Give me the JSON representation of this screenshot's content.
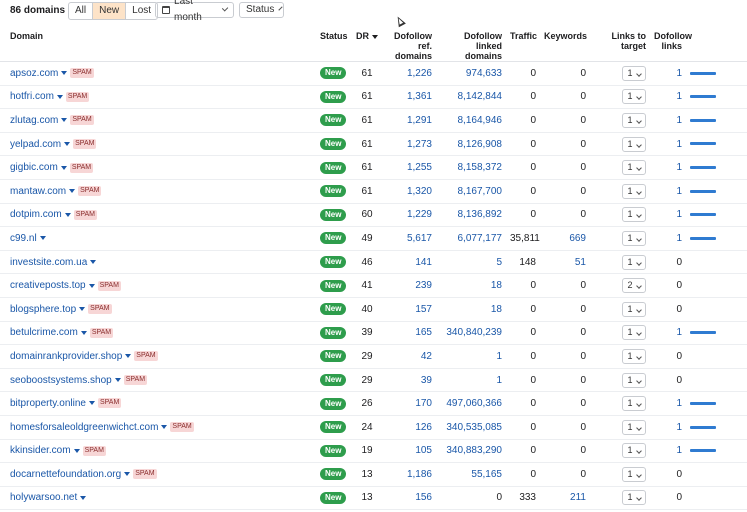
{
  "toolbar": {
    "count": "86 domains",
    "filters": [
      "All",
      "New",
      "Lost"
    ],
    "active_filter": "New",
    "date_range": "Last month",
    "status": "Status"
  },
  "table": {
    "headers": {
      "domain": "Domain",
      "status": "Status",
      "dr": "DR",
      "ref_domains": "Dofollow ref. domains",
      "linked_domains": "Dofollow linked domains",
      "traffic": "Traffic",
      "keywords": "Keywords",
      "links_to_target": "Links to target",
      "dofollow_links": "Dofollow links"
    },
    "rows": [
      {
        "domain": "apsoz.com",
        "spam": true,
        "status": "New",
        "dr": "61",
        "ref": "1,226",
        "linked": "974,633",
        "traffic": "0",
        "keywords": "0",
        "ltt": "1",
        "dl": "1",
        "bar": true
      },
      {
        "domain": "hotfri.com",
        "spam": true,
        "status": "New",
        "dr": "61",
        "ref": "1,361",
        "linked": "8,142,844",
        "traffic": "0",
        "keywords": "0",
        "ltt": "1",
        "dl": "1",
        "bar": true
      },
      {
        "domain": "zlutag.com",
        "spam": true,
        "status": "New",
        "dr": "61",
        "ref": "1,291",
        "linked": "8,164,946",
        "traffic": "0",
        "keywords": "0",
        "ltt": "1",
        "dl": "1",
        "bar": true
      },
      {
        "domain": "yelpad.com",
        "spam": true,
        "status": "New",
        "dr": "61",
        "ref": "1,273",
        "linked": "8,126,908",
        "traffic": "0",
        "keywords": "0",
        "ltt": "1",
        "dl": "1",
        "bar": true
      },
      {
        "domain": "gigbic.com",
        "spam": true,
        "status": "New",
        "dr": "61",
        "ref": "1,255",
        "linked": "8,158,372",
        "traffic": "0",
        "keywords": "0",
        "ltt": "1",
        "dl": "1",
        "bar": true
      },
      {
        "domain": "mantaw.com",
        "spam": true,
        "status": "New",
        "dr": "61",
        "ref": "1,320",
        "linked": "8,167,700",
        "traffic": "0",
        "keywords": "0",
        "ltt": "1",
        "dl": "1",
        "bar": true
      },
      {
        "domain": "dotpim.com",
        "spam": true,
        "status": "New",
        "dr": "60",
        "ref": "1,229",
        "linked": "8,136,892",
        "traffic": "0",
        "keywords": "0",
        "ltt": "1",
        "dl": "1",
        "bar": true
      },
      {
        "domain": "c99.nl",
        "spam": false,
        "status": "New",
        "dr": "49",
        "ref": "5,617",
        "linked": "6,077,177",
        "traffic": "35,811",
        "keywords": "669",
        "ltt": "1",
        "dl": "1",
        "bar": true
      },
      {
        "domain": "investsite.com.ua",
        "spam": false,
        "status": "New",
        "dr": "46",
        "ref": "141",
        "linked": "5",
        "traffic": "148",
        "keywords": "51",
        "ltt": "1",
        "dl": "0",
        "bar": false
      },
      {
        "domain": "creativeposts.top",
        "spam": true,
        "status": "New",
        "dr": "41",
        "ref": "239",
        "linked": "18",
        "traffic": "0",
        "keywords": "0",
        "ltt": "2",
        "dl": "0",
        "bar": false
      },
      {
        "domain": "blogsphere.top",
        "spam": true,
        "status": "New",
        "dr": "40",
        "ref": "157",
        "linked": "18",
        "traffic": "0",
        "keywords": "0",
        "ltt": "1",
        "dl": "0",
        "bar": false
      },
      {
        "domain": "betulcrime.com",
        "spam": true,
        "status": "New",
        "dr": "39",
        "ref": "165",
        "linked": "340,840,239",
        "traffic": "0",
        "keywords": "0",
        "ltt": "1",
        "dl": "1",
        "bar": true
      },
      {
        "domain": "domainrankprovider.shop",
        "spam": true,
        "status": "New",
        "dr": "29",
        "ref": "42",
        "linked": "1",
        "traffic": "0",
        "keywords": "0",
        "ltt": "1",
        "dl": "0",
        "bar": false
      },
      {
        "domain": "seoboostsystems.shop",
        "spam": true,
        "status": "New",
        "dr": "29",
        "ref": "39",
        "linked": "1",
        "traffic": "0",
        "keywords": "0",
        "ltt": "1",
        "dl": "0",
        "bar": false
      },
      {
        "domain": "bitproperty.online",
        "spam": true,
        "status": "New",
        "dr": "26",
        "ref": "170",
        "linked": "497,060,366",
        "traffic": "0",
        "keywords": "0",
        "ltt": "1",
        "dl": "1",
        "bar": true
      },
      {
        "domain": "homesforsaleoldgreenwichct.com",
        "spam": true,
        "status": "New",
        "dr": "24",
        "ref": "126",
        "linked": "340,535,085",
        "traffic": "0",
        "keywords": "0",
        "ltt": "1",
        "dl": "1",
        "bar": true
      },
      {
        "domain": "kkinsider.com",
        "spam": true,
        "status": "New",
        "dr": "19",
        "ref": "105",
        "linked": "340,883,290",
        "traffic": "0",
        "keywords": "0",
        "ltt": "1",
        "dl": "1",
        "bar": true
      },
      {
        "domain": "docarnettefoundation.org",
        "spam": true,
        "status": "New",
        "dr": "13",
        "ref": "1,186",
        "linked": "55,165",
        "traffic": "0",
        "keywords": "0",
        "ltt": "1",
        "dl": "0",
        "bar": false
      },
      {
        "domain": "holywarsoo.net",
        "spam": false,
        "status": "New",
        "dr": "13",
        "ref": "156",
        "linked": "0",
        "traffic": "333",
        "keywords": "211",
        "ltt": "1",
        "dl": "0",
        "bar": false
      }
    ]
  },
  "labels": {
    "spam": "SPAM"
  },
  "colors": {
    "accent": "#1a57a8",
    "new_badge": "#2e9d4c",
    "spam_bg": "#f7d6d6",
    "active_filter_bg": "#fde3c8",
    "bar": "#2f7bd1"
  }
}
